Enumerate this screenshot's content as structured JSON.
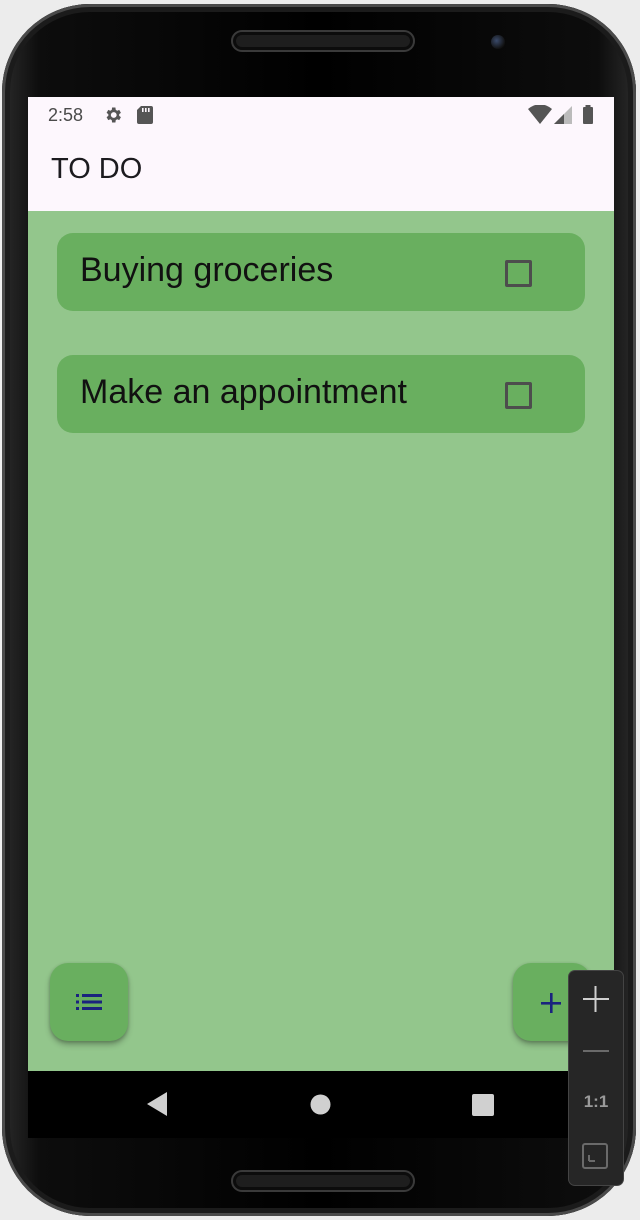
{
  "status_bar": {
    "time": "2:58",
    "left_icons": [
      "gear-icon",
      "sd-card-icon"
    ],
    "right_icons": [
      "wifi-icon",
      "cell-signal-icon",
      "battery-icon"
    ]
  },
  "app_bar": {
    "title": "TO DO"
  },
  "todos": [
    {
      "label": "Buying groceries",
      "checked": false
    },
    {
      "label": "Make an appointment",
      "checked": false
    }
  ],
  "fabs": {
    "left_icon": "list-icon",
    "right_icon": "plus-icon"
  },
  "nav_bar": [
    "back-icon",
    "home-icon",
    "recents-icon"
  ],
  "zoom_controls": {
    "one_to_one_label": "1:1",
    "items": [
      "zoom-in-icon",
      "zoom-out-icon",
      "fit-screen-icon"
    ]
  },
  "colors": {
    "background": "#93c68c",
    "card": "#69af5f",
    "app_bar": "#fdf7fd",
    "fab_icon": "#1a237e"
  }
}
